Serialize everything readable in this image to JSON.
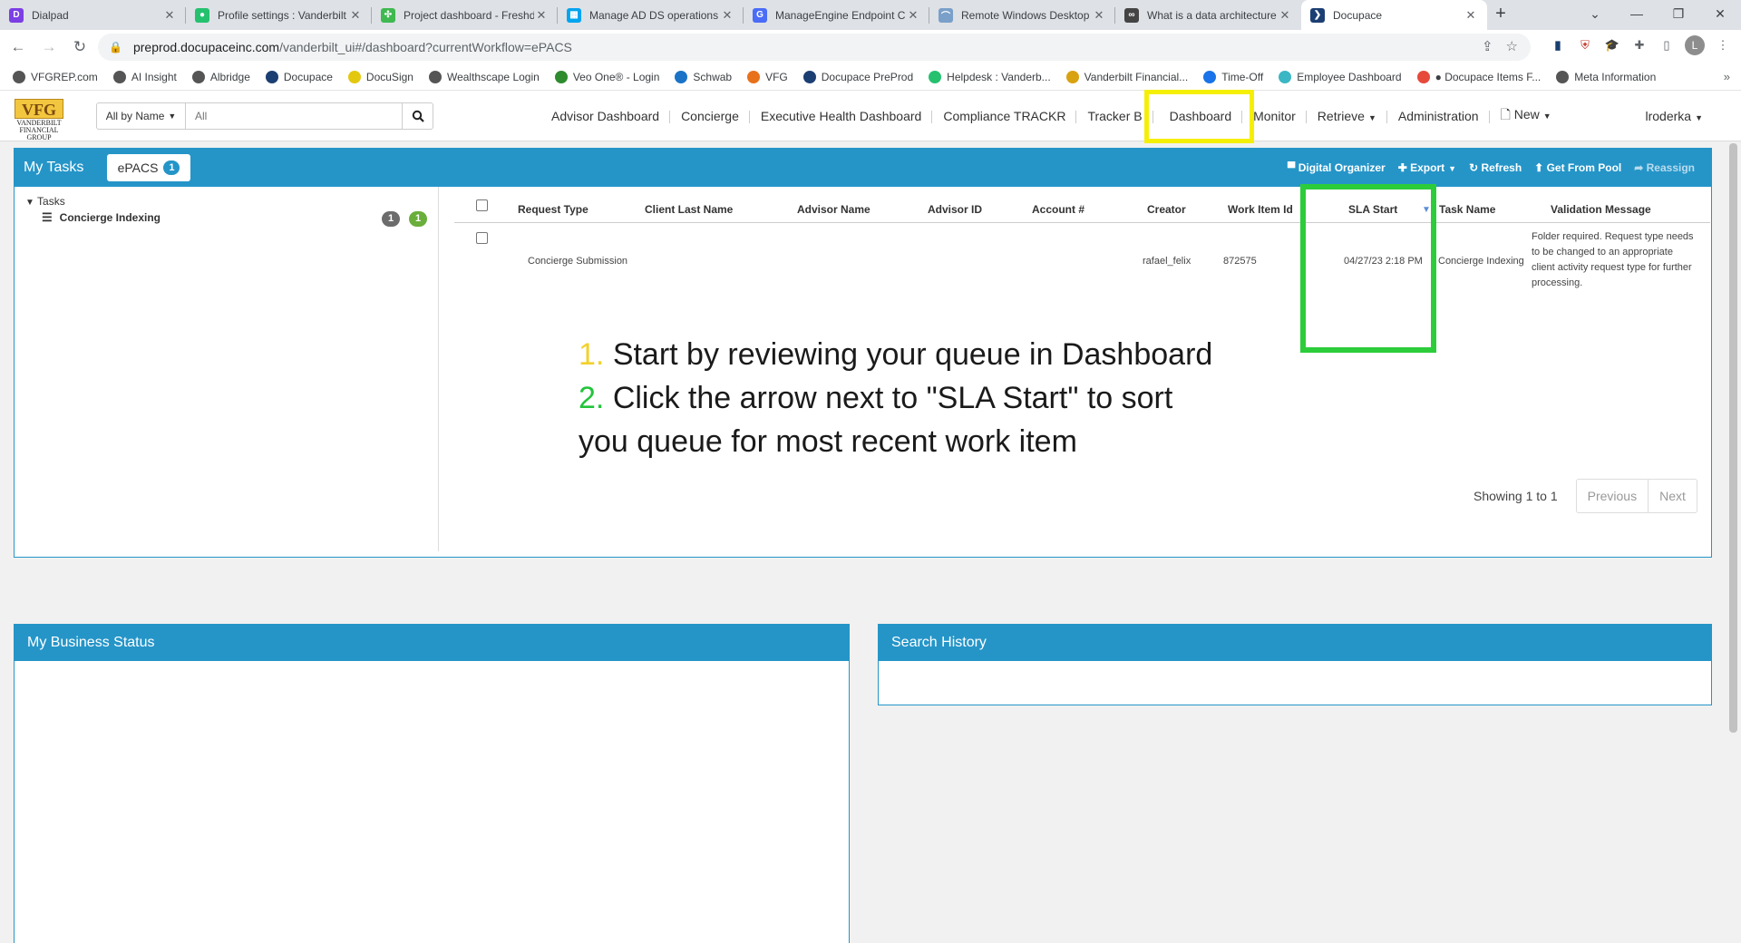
{
  "browser": {
    "tabs": [
      {
        "title": "Dialpad",
        "icon": "dialpad-icon",
        "color": "#7b3fe4",
        "glyph": "D"
      },
      {
        "title": "Profile settings : Vanderbilt",
        "icon": "freshdesk-icon",
        "color": "#25c16f",
        "glyph": "●"
      },
      {
        "title": "Project dashboard - Freshd",
        "icon": "freshworks-icon",
        "color": "#3fb950",
        "glyph": "✣"
      },
      {
        "title": "Manage AD DS operations",
        "icon": "windows-icon",
        "color": "#00a4ef",
        "glyph": "▦"
      },
      {
        "title": "ManageEngine Endpoint C",
        "icon": "manageengine-icon",
        "color": "#4a6cf7",
        "glyph": "G"
      },
      {
        "title": "Remote Windows Desktop",
        "icon": "remote-icon",
        "color": "#7aa0c9",
        "glyph": "⌒"
      },
      {
        "title": "What is a data architecture",
        "icon": "binoculars-icon",
        "color": "#444444",
        "glyph": "∞"
      },
      {
        "title": "Docupace",
        "icon": "docupace-icon",
        "color": "#1c3f73",
        "glyph": "❯"
      }
    ],
    "url_host": "preprod.docupaceinc.com",
    "url_path": "/vanderbilt_ui#/dashboard?currentWorkflow=ePACS",
    "profile_initial": "L",
    "bookmarks": [
      {
        "label": "VFGREP.com",
        "color": "#555555"
      },
      {
        "label": "AI Insight",
        "color": "#555555"
      },
      {
        "label": "Albridge",
        "color": "#555555"
      },
      {
        "label": "Docupace",
        "color": "#1c3f73"
      },
      {
        "label": "DocuSign",
        "color": "#e3c80f"
      },
      {
        "label": "Wealthscape Login",
        "color": "#555555"
      },
      {
        "label": "Veo One® - Login",
        "color": "#2e8b2e"
      },
      {
        "label": "Schwab",
        "color": "#1a73c7"
      },
      {
        "label": "VFG",
        "color": "#e8711b"
      },
      {
        "label": "Docupace PreProd",
        "color": "#1c3f73"
      },
      {
        "label": "Helpdesk : Vanderb...",
        "color": "#25c16f"
      },
      {
        "label": "Vanderbilt Financial...",
        "color": "#d8a210"
      },
      {
        "label": "Time-Off",
        "color": "#1a73e8"
      },
      {
        "label": "Employee Dashboard",
        "color": "#3bb6c4"
      },
      {
        "label": "● Docupace Items F...",
        "color": "#e64a3b"
      },
      {
        "label": "Meta Information",
        "color": "#555555"
      }
    ]
  },
  "app": {
    "logo_text": "VFG",
    "logo_sub": "VANDERBILT FINANCIAL GROUP",
    "search": {
      "scope": "All by Name",
      "placeholder": "All"
    },
    "nav": [
      {
        "label": "Advisor Dashboard"
      },
      {
        "label": "Concierge"
      },
      {
        "label": "Executive Health Dashboard"
      },
      {
        "label": "Compliance TRACKR"
      },
      {
        "label": "Tracker B"
      },
      {
        "label": "Dashboard"
      },
      {
        "label": "Monitor"
      },
      {
        "label": "Retrieve"
      },
      {
        "label": "Administration"
      },
      {
        "label": "New"
      }
    ],
    "user": "lroderka"
  },
  "tasks_panel": {
    "title": "My Tasks",
    "workflow_tab": "ePACS",
    "workflow_count": "1",
    "toolbar": {
      "digital_organizer": "Digital Organizer",
      "export": "Export",
      "refresh": "Refresh",
      "get_from_pool": "Get From Pool",
      "reassign": "Reassign"
    },
    "tree": {
      "root": "Tasks",
      "item": "Concierge Indexing",
      "count_gray": "1",
      "count_green": "1"
    },
    "columns": {
      "request_type": "Request Type",
      "client_last_name": "Client Last Name",
      "advisor_name": "Advisor Name",
      "advisor_id": "Advisor ID",
      "account": "Account #",
      "creator": "Creator",
      "work_item_id": "Work Item Id",
      "sla_start": "SLA Start",
      "task_name": "Task Name",
      "validation_message": "Validation Message"
    },
    "rows": [
      {
        "request_type": "Concierge Submission",
        "creator": "rafael_felix",
        "work_item_id": "872575",
        "sla_start": "04/27/23 2:18 PM",
        "task_name": "Concierge Indexing",
        "validation_message": "Folder required. Request type needs to be changed to an appropriate client activity request type for further processing."
      }
    ],
    "pager": {
      "showing": "Showing 1 to 1",
      "previous": "Previous",
      "next": "Next"
    }
  },
  "instructions": {
    "step1_num": "1.",
    "step1_text": "Start by reviewing your queue in Dashboard",
    "step2_num": "2.",
    "step2_text": "Click the arrow next to \"SLA Start\" to sort you queue for most recent work item"
  },
  "business_status": {
    "title": "My Business Status"
  },
  "search_history": {
    "title": "Search History"
  },
  "colors": {
    "panel_blue": "#2595c8",
    "highlight_yellow": "#f5ef07",
    "highlight_green": "#2ccc3a"
  }
}
